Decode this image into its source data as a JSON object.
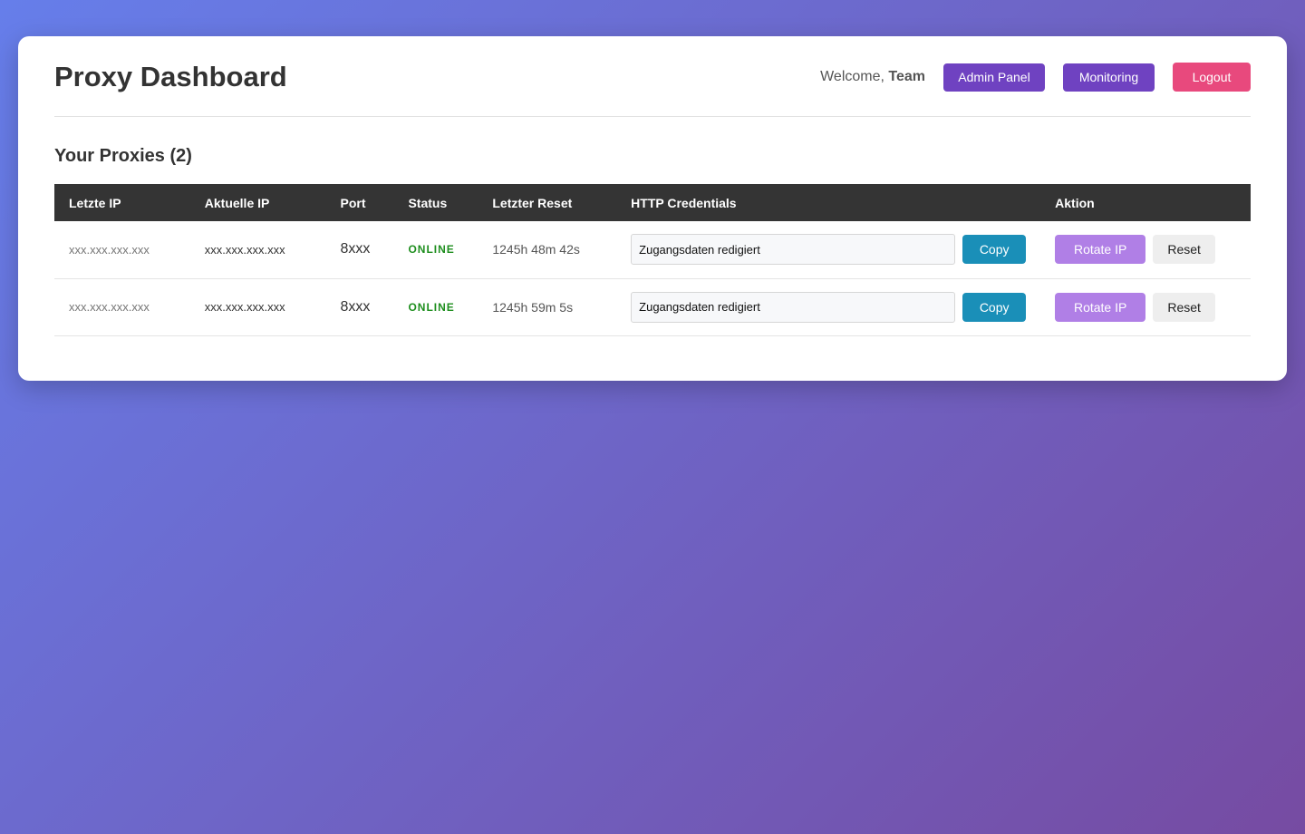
{
  "header": {
    "title": "Proxy Dashboard",
    "welcome_prefix": "Welcome, ",
    "username": "Team",
    "admin_label": "Admin Panel",
    "monitoring_label": "Monitoring",
    "logout_label": "Logout"
  },
  "section": {
    "title": "Your Proxies (2)"
  },
  "table": {
    "columns": [
      "Letzte IP",
      "Aktuelle IP",
      "Port",
      "Status",
      "Letzter Reset",
      "HTTP Credentials",
      "Aktion"
    ],
    "rows": [
      {
        "last_ip": "xxx.xxx.xxx.xxx",
        "current_ip": "xxx.xxx.xxx.xxx",
        "port": "8xxx",
        "status": "ONLINE",
        "last_reset": "1245h 48m 42s",
        "credentials": "Zugangsdaten redigiert",
        "copy_label": "Copy",
        "rotate_label": "Rotate IP",
        "reset_label": "Reset"
      },
      {
        "last_ip": "xxx.xxx.xxx.xxx",
        "current_ip": "xxx.xxx.xxx.xxx",
        "port": "8xxx",
        "status": "ONLINE",
        "last_reset": "1245h 59m 5s",
        "credentials": "Zugangsdaten redigiert",
        "copy_label": "Copy",
        "rotate_label": "Rotate IP",
        "reset_label": "Reset"
      }
    ]
  },
  "colors": {
    "background_start": "#667eea",
    "background_end": "#764ba2",
    "admin_button": "#6f42c1",
    "logout_button": "#e8497d",
    "copy_button": "#1a8fb8",
    "rotate_button": "#b07fe6",
    "status_online": "#1e8e1e",
    "table_header": "#343434"
  }
}
